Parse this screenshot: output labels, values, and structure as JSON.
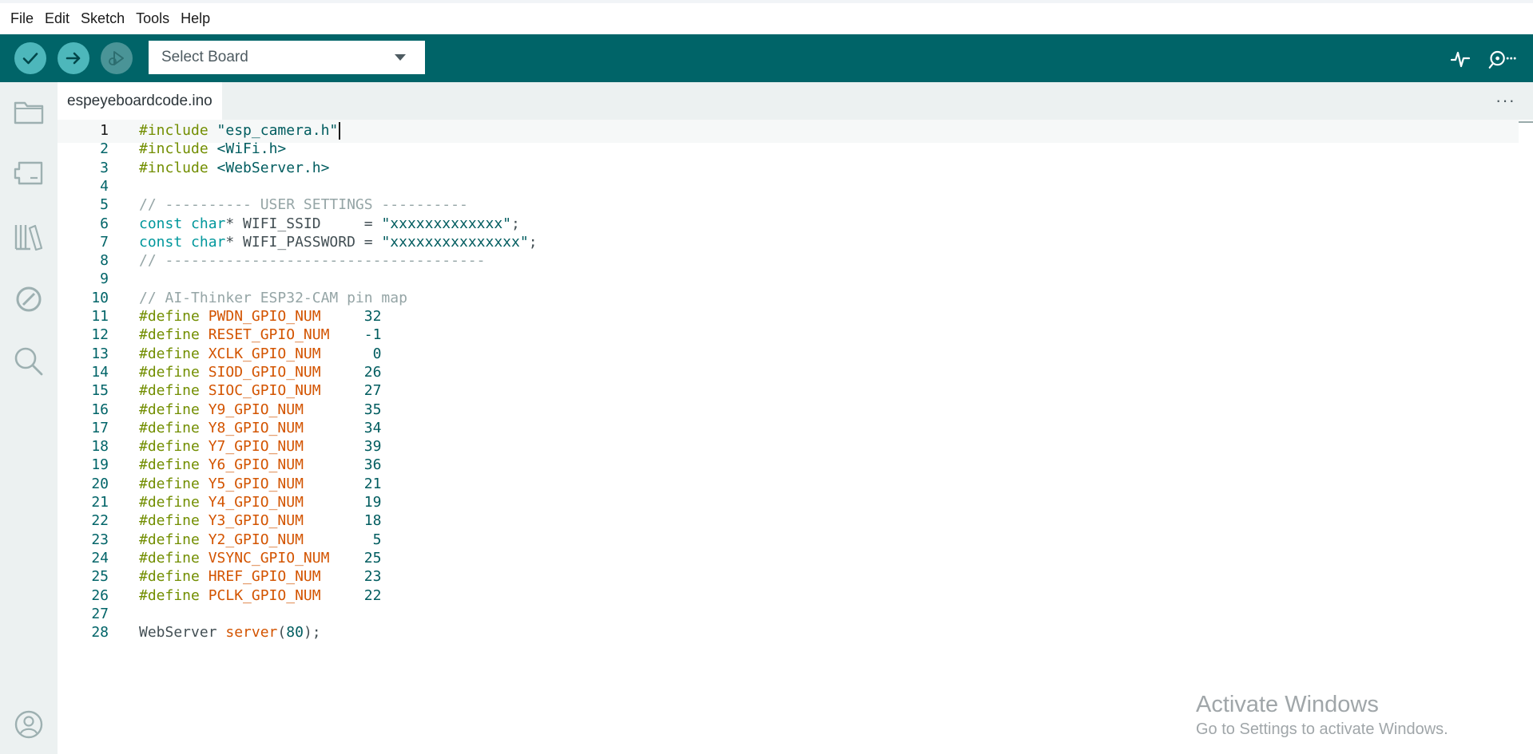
{
  "menu": [
    "File",
    "Edit",
    "Sketch",
    "Tools",
    "Help"
  ],
  "toolbar": {
    "verify_icon": "check-icon",
    "upload_icon": "arrow-right-icon",
    "debug_icon": "debug-icon",
    "board_select": "Select Board",
    "serial_plotter_icon": "pulse-icon",
    "serial_monitor_icon": "magnifier-dots-icon"
  },
  "sidebar": [
    "folder-icon",
    "board-icon",
    "library-icon",
    "debug-block-icon",
    "search-icon",
    "account-icon"
  ],
  "tab": {
    "filename": "espeyeboardcode.ino",
    "more": "···"
  },
  "editor": {
    "lines": [
      [
        [
          "pre",
          "#include "
        ],
        [
          "str",
          "\"esp_camera.h\""
        ]
      ],
      [
        [
          "pre",
          "#include "
        ],
        [
          "str",
          "<WiFi.h>"
        ]
      ],
      [
        [
          "pre",
          "#include "
        ],
        [
          "str",
          "<WebServer.h>"
        ]
      ],
      [],
      [
        [
          "cmt",
          "// ---------- USER SETTINGS ----------"
        ]
      ],
      [
        [
          "type",
          "const char"
        ],
        [
          "plain",
          "* WIFI_SSID     = "
        ],
        [
          "str",
          "\"xxxxxxxxxxxxx\""
        ],
        [
          "plain",
          ";"
        ]
      ],
      [
        [
          "type",
          "const char"
        ],
        [
          "plain",
          "* WIFI_PASSWORD = "
        ],
        [
          "str",
          "\"xxxxxxxxxxxxxxx\""
        ],
        [
          "plain",
          ";"
        ]
      ],
      [
        [
          "cmt",
          "// -------------------------------------"
        ]
      ],
      [],
      [
        [
          "cmt",
          "// AI-Thinker ESP32-CAM pin map"
        ]
      ],
      [
        [
          "pre",
          "#define "
        ],
        [
          "def",
          "PWDN_GPIO_NUM"
        ],
        [
          "plain",
          "     "
        ],
        [
          "num",
          "32"
        ]
      ],
      [
        [
          "pre",
          "#define "
        ],
        [
          "def",
          "RESET_GPIO_NUM"
        ],
        [
          "plain",
          "    "
        ],
        [
          "num",
          "-1"
        ]
      ],
      [
        [
          "pre",
          "#define "
        ],
        [
          "def",
          "XCLK_GPIO_NUM"
        ],
        [
          "plain",
          "      "
        ],
        [
          "num",
          "0"
        ]
      ],
      [
        [
          "pre",
          "#define "
        ],
        [
          "def",
          "SIOD_GPIO_NUM"
        ],
        [
          "plain",
          "     "
        ],
        [
          "num",
          "26"
        ]
      ],
      [
        [
          "pre",
          "#define "
        ],
        [
          "def",
          "SIOC_GPIO_NUM"
        ],
        [
          "plain",
          "     "
        ],
        [
          "num",
          "27"
        ]
      ],
      [
        [
          "pre",
          "#define "
        ],
        [
          "def",
          "Y9_GPIO_NUM"
        ],
        [
          "plain",
          "       "
        ],
        [
          "num",
          "35"
        ]
      ],
      [
        [
          "pre",
          "#define "
        ],
        [
          "def",
          "Y8_GPIO_NUM"
        ],
        [
          "plain",
          "       "
        ],
        [
          "num",
          "34"
        ]
      ],
      [
        [
          "pre",
          "#define "
        ],
        [
          "def",
          "Y7_GPIO_NUM"
        ],
        [
          "plain",
          "       "
        ],
        [
          "num",
          "39"
        ]
      ],
      [
        [
          "pre",
          "#define "
        ],
        [
          "def",
          "Y6_GPIO_NUM"
        ],
        [
          "plain",
          "       "
        ],
        [
          "num",
          "36"
        ]
      ],
      [
        [
          "pre",
          "#define "
        ],
        [
          "def",
          "Y5_GPIO_NUM"
        ],
        [
          "plain",
          "       "
        ],
        [
          "num",
          "21"
        ]
      ],
      [
        [
          "pre",
          "#define "
        ],
        [
          "def",
          "Y4_GPIO_NUM"
        ],
        [
          "plain",
          "       "
        ],
        [
          "num",
          "19"
        ]
      ],
      [
        [
          "pre",
          "#define "
        ],
        [
          "def",
          "Y3_GPIO_NUM"
        ],
        [
          "plain",
          "       "
        ],
        [
          "num",
          "18"
        ]
      ],
      [
        [
          "pre",
          "#define "
        ],
        [
          "def",
          "Y2_GPIO_NUM"
        ],
        [
          "plain",
          "        "
        ],
        [
          "num",
          "5"
        ]
      ],
      [
        [
          "pre",
          "#define "
        ],
        [
          "def",
          "VSYNC_GPIO_NUM"
        ],
        [
          "plain",
          "    "
        ],
        [
          "num",
          "25"
        ]
      ],
      [
        [
          "pre",
          "#define "
        ],
        [
          "def",
          "HREF_GPIO_NUM"
        ],
        [
          "plain",
          "     "
        ],
        [
          "num",
          "23"
        ]
      ],
      [
        [
          "pre",
          "#define "
        ],
        [
          "def",
          "PCLK_GPIO_NUM"
        ],
        [
          "plain",
          "     "
        ],
        [
          "num",
          "22"
        ]
      ],
      [],
      [
        [
          "plain",
          "WebServer "
        ],
        [
          "fn",
          "server"
        ],
        [
          "plain",
          "("
        ],
        [
          "num",
          "80"
        ],
        [
          "plain",
          ");"
        ]
      ]
    ]
  },
  "watermark": {
    "title": "Activate Windows",
    "subtitle": "Go to Settings to activate Windows."
  },
  "colors": {
    "toolbar_bg": "#006468",
    "button_active": "#4db7bb",
    "sidebar_bg": "#ecf1f1",
    "preprocessor": "#728e00",
    "string": "#005c5f",
    "comment": "#95a5a6",
    "type": "#00979c",
    "define_name": "#d35400"
  }
}
